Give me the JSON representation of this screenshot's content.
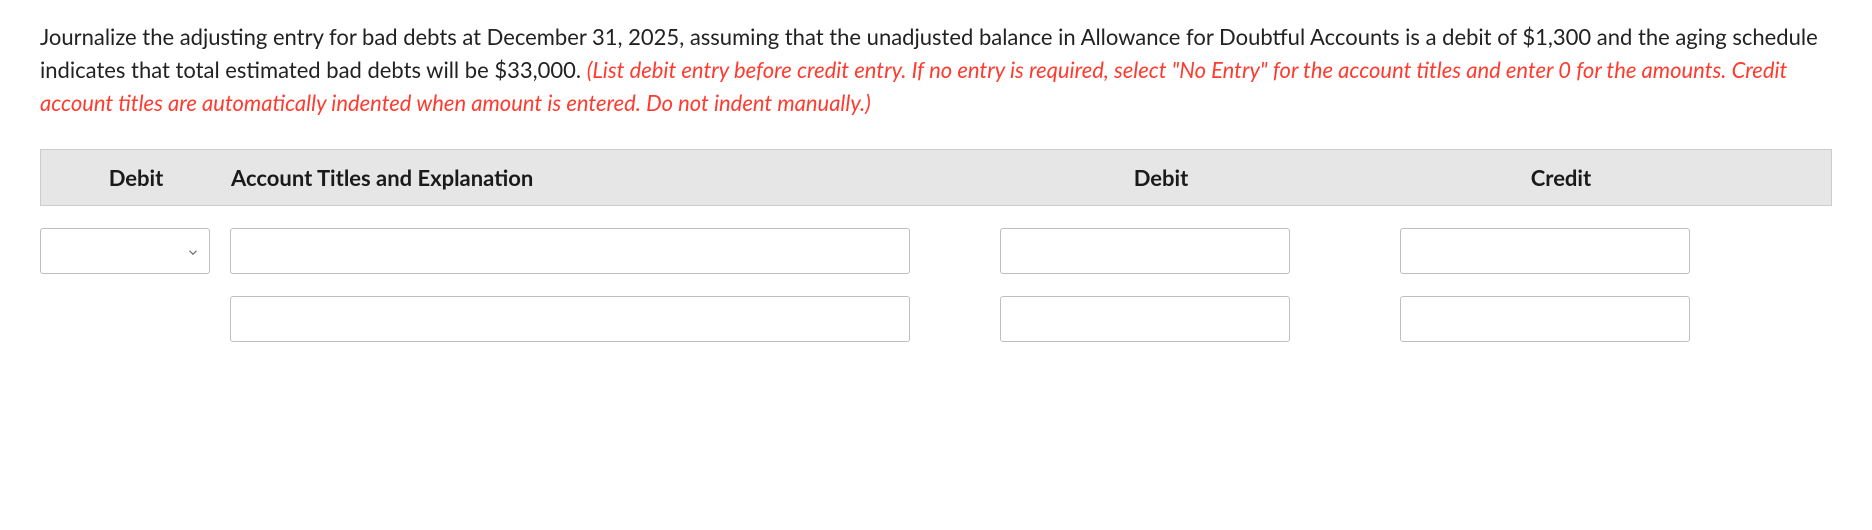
{
  "question": {
    "black": "Journalize the adjusting entry for bad debts at December 31, 2025, assuming that the unadjusted balance in Allowance for Doubtful Accounts is a debit of $1,300 and the aging schedule indicates that total estimated bad debts will be $33,000. ",
    "red": "(List debit entry before credit entry. If no entry is required, select \"No Entry\" for the account titles and enter 0 for the amounts. Credit account titles are automatically indented when amount is entered. Do not indent manually.)"
  },
  "table": {
    "headers": {
      "col1": "Debit",
      "col2": "Account Titles and Explanation",
      "col3": "Debit",
      "col4": "Credit"
    },
    "rows": [
      {
        "date_select": "",
        "title": "",
        "debit": "",
        "credit": ""
      },
      {
        "date_select": null,
        "title": "",
        "debit": "",
        "credit": ""
      }
    ]
  }
}
